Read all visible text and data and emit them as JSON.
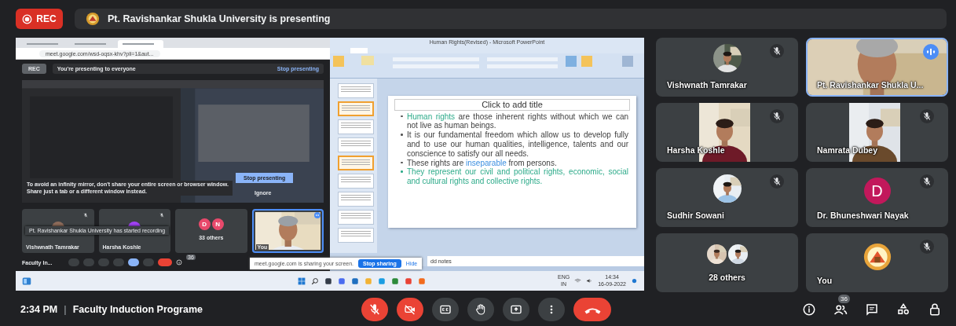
{
  "rec_button": {
    "label": "REC"
  },
  "presenting_banner": {
    "text": "Pt. Ravishankar Shukla University is presenting"
  },
  "shared_screen": {
    "browser": {
      "tabs": [
        {
          "selected": false
        },
        {
          "selected": false
        },
        {
          "selected": true
        }
      ],
      "url": "meet.google.com/wsd-oqsx-khv?pli=1&aut..."
    },
    "meet": {
      "rec_label": "REC",
      "presenting_text": "You're presenting to everyone",
      "stop_presenting": "Stop presenting",
      "mirror_warning": "To avoid an infinity mirror, don't share your entire screen or browser window. Share just a tab or a different window instead.",
      "mirror_stop": "Stop presenting",
      "mirror_ignore": "Ignore",
      "tiles": [
        {
          "kind": "avatar",
          "name": "Vishwnath Tamrakar",
          "muted": true,
          "speaking": false
        },
        {
          "kind": "avatar",
          "name": "Harsha Koshle",
          "muted": true,
          "speaking": false
        },
        {
          "kind": "group",
          "name": "33 others",
          "initials": [
            "D",
            "N"
          ],
          "muted": false,
          "speaking": false
        },
        {
          "kind": "video",
          "name": "You",
          "muted": false,
          "speaking": true
        }
      ],
      "toast": "Pt. Ravishankar Shukla University has started recording",
      "participant_count": "36",
      "meeting_name": "Faculty In...",
      "share_bar": {
        "text": "meet.google.com is sharing your screen.",
        "stop": "Stop sharing",
        "hide": "Hide"
      }
    },
    "powerpoint": {
      "title": "Human Rights(Revised) - Microsoft PowerPoint",
      "thumbnails": [
        {
          "selected": false
        },
        {
          "selected": true
        },
        {
          "selected": false
        },
        {
          "selected": false
        },
        {
          "selected": true
        },
        {
          "selected": false
        },
        {
          "selected": false
        },
        {
          "selected": false
        },
        {
          "selected": false
        }
      ],
      "slide": {
        "title": "Click to add title",
        "bullets": [
          [
            {
              "kind": "green",
              "text": "Human rights"
            },
            {
              "kind": "plain",
              "text": " are those inherent rights without which we can not live as human beings."
            }
          ],
          [
            {
              "kind": "plain",
              "text": "It is our fundamental freedom which allow us to develop fully and to use our human qualities, intelligence, talents and our conscience to satisfy our all needs."
            }
          ],
          [
            {
              "kind": "plain",
              "text": "These rights are "
            },
            {
              "kind": "blue",
              "text": "inseparable"
            },
            {
              "kind": "plain",
              "text": " from persons."
            }
          ],
          [
            {
              "kind": "green",
              "text": "They represent our civil and political rights, economic, social and cultural rights and collective rights."
            }
          ]
        ]
      },
      "notes": "dd notes"
    },
    "taskbar": {
      "language": "ENG",
      "region": "IN",
      "time": "14:34",
      "date": "16-09-2022"
    }
  },
  "tiles": [
    {
      "kind": "avatar",
      "name": "Vishwnath Tamrakar",
      "muted": true,
      "speaking": false
    },
    {
      "kind": "video",
      "name": "Pt. Ravishankar Shukla U...",
      "muted": false,
      "speaking": true
    },
    {
      "kind": "video-strip",
      "name": "Harsha Koshle",
      "muted": true,
      "speaking": false
    },
    {
      "kind": "video-strip",
      "name": "Namrata Dubey",
      "muted": true,
      "speaking": false
    },
    {
      "kind": "avatar",
      "name": "Sudhir Sowani",
      "muted": true,
      "speaking": false
    },
    {
      "kind": "initial",
      "name": "Dr. Bhuneshwari Nayak",
      "initial": "D",
      "color": "#c2185b",
      "muted": true,
      "speaking": false
    },
    {
      "kind": "group",
      "name": "28 others",
      "muted": false,
      "speaking": false
    },
    {
      "kind": "logo",
      "name": "You",
      "muted": true,
      "speaking": false
    }
  ],
  "bottom_bar": {
    "time": "2:34 PM",
    "separator": "|",
    "meeting_name": "Faculty Induction Programe",
    "mic_on": false,
    "camera_on": false,
    "participant_count": "36"
  }
}
